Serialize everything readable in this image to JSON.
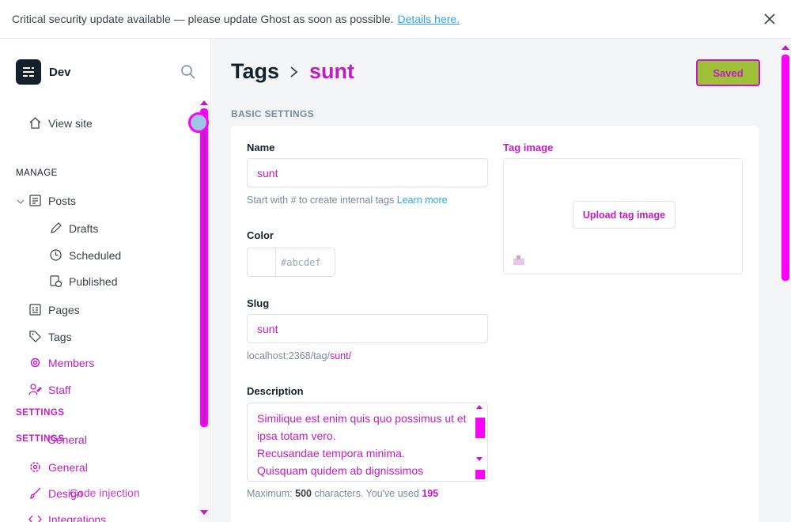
{
  "banner": {
    "text": "Critical security update available — please update Ghost as soon as possible.",
    "link": "Details here."
  },
  "sidebar": {
    "site_name": "Dev",
    "view_site": "View site",
    "manage_heading": "MANAGE",
    "posts": "Posts",
    "drafts": "Drafts",
    "scheduled": "Scheduled",
    "published": "Published",
    "pages": "Pages",
    "tags": "Tags",
    "members": "Members",
    "staff": "Staff",
    "settings_heading": "SETTINGS",
    "settings_heading_2": "SETTINGS",
    "general_1": "General",
    "general_2": "General",
    "design": "Design",
    "code_injection": "Code injection",
    "integrations": "Integrations"
  },
  "header": {
    "crumb_root": "Tags",
    "crumb_current": "sunt",
    "save_label": "Saved"
  },
  "form": {
    "section_title": "BASIC SETTINGS",
    "name_label": "Name",
    "name_value": "sunt",
    "name_hint": "Start with # to create internal tags",
    "name_hint_link": "Learn more",
    "color_label": "Color",
    "color_hash": "#",
    "color_placeholder": "abcdef",
    "slug_label": "Slug",
    "slug_value": "sunt",
    "slug_url_prefix": "localhost:2368/tag/",
    "slug_url_value": "sunt",
    "slug_url_suffix": "/",
    "description_label": "Description",
    "description_value": "Similique est enim quis quo possimus ut et ipsa totam vero.\nRecusandae tempora minima.\nQuisquam quidem ab dignissimos",
    "desc_hint_prefix": "Maximum:",
    "desc_hint_max": "500",
    "desc_hint_mid": "characters. You've used",
    "desc_hint_used": "195",
    "tag_image_label": "Tag image",
    "upload_label": "Upload tag image"
  },
  "colors": {
    "accent": "#c21bc2",
    "save_bg": "#9fc138",
    "link": "#30a3e6",
    "scrollbar": "#ff00ff"
  },
  "icons": [
    "close-icon",
    "logo-icon",
    "search-icon",
    "home-icon",
    "chevron-down-icon",
    "posts-icon",
    "pencil-icon",
    "clock-icon",
    "published-icon",
    "pages-icon",
    "tag-icon",
    "members-icon",
    "staff-icon",
    "gear-icon",
    "brush-icon",
    "code-icon",
    "chevron-right-icon",
    "image-icon"
  ]
}
